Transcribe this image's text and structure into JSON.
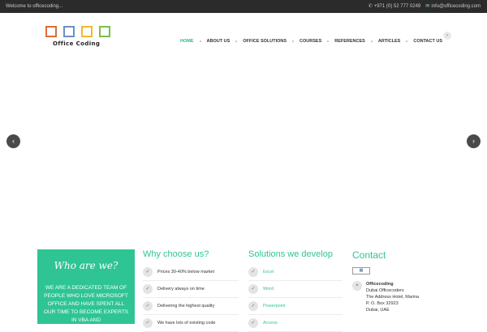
{
  "topbar": {
    "welcome": "Welcome to officecoding...",
    "phone": "+971 (0) 52 777 0249",
    "email": "info@officecoding.com"
  },
  "logo": {
    "text": "Office Coding",
    "square_colors": [
      "#e06b3b",
      "#6b8fc7",
      "#f0b92d",
      "#7abf4a"
    ]
  },
  "nav": {
    "items": [
      "HOME",
      "ABOUT US",
      "OFFICE SOLUTIONS",
      "COURSES",
      "REFERENCES",
      "ARTICLES",
      "CONTACT US"
    ],
    "active": "HOME"
  },
  "slider": {
    "prev_icon": "chevron-left-icon",
    "next_icon": "chevron-right-icon"
  },
  "who": {
    "title": "Who are we?",
    "text": "WE ARE A DEDICATED TEAM OF PEOPLE WHO LOVE MICROSOFT OFFICE AND HAVE SPENT ALL OUR TIME TO BECOME EXPERTS IN VBA AND"
  },
  "why": {
    "title": "Why choose us?",
    "items": [
      "Prices 30-40% below market",
      "Delivery always on time",
      "Delivering the highest quality",
      "We have lots of existing code"
    ]
  },
  "solutions": {
    "title": "Solutions we develop",
    "items": [
      "Excel",
      "Word",
      "Powerpoint",
      "Access"
    ]
  },
  "contact": {
    "title": "Contact",
    "company": "Officecoding",
    "lines": [
      "Dubai Officecoders",
      "The Address Hotel, Marina",
      "P. O. Box 32923",
      "Dubai, UAE"
    ]
  },
  "colors": {
    "accent": "#2fc494",
    "topbar": "#2b2b2b"
  }
}
